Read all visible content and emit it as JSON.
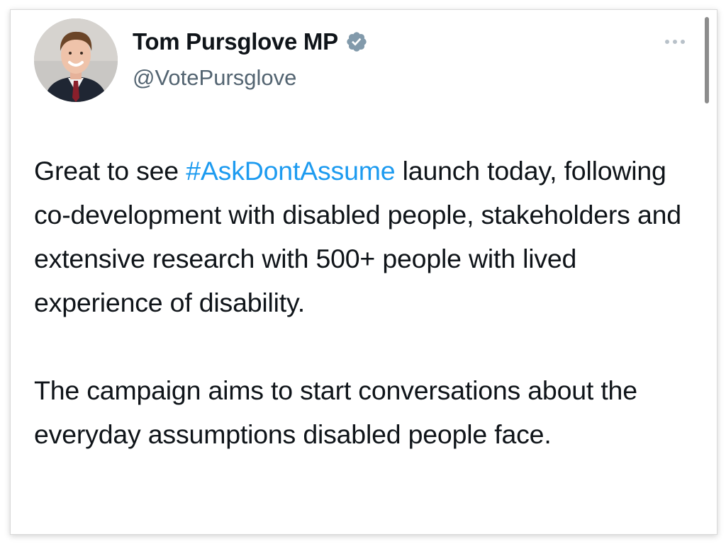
{
  "tweet": {
    "author": {
      "display_name": "Tom Pursglove MP",
      "handle": "@VotePursglove",
      "verified_icon": "verified-badge-icon",
      "avatar_icon": "profile-photo"
    },
    "more_icon": "more-options-icon",
    "body": {
      "p1_before": "Great to see ",
      "p1_hashtag": "#AskDontAssume",
      "p1_after": " launch today, following co-development with disabled people, stakeholders and extensive research with 500+ people with lived experience of disability.",
      "p2": "The campaign aims to start conversations about the everyday assumptions disabled people face."
    }
  },
  "colors": {
    "text": "#0f1419",
    "secondary": "#536471",
    "link": "#1d9bf0",
    "verified": "#829aab"
  }
}
